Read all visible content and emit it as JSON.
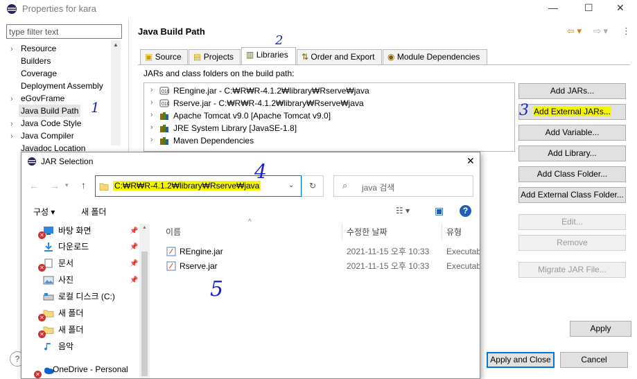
{
  "window": {
    "title": "Properties for kara",
    "filter_placeholder": "type filter text",
    "tree": [
      "Resource",
      "Builders",
      "Coverage",
      "Deployment Assembly",
      "eGovFrame",
      "Java Build Path",
      "Java Code Style",
      "Java Compiler",
      "Javadoc Location"
    ]
  },
  "page": {
    "heading": "Java Build Path",
    "tabs": [
      "Source",
      "Projects",
      "Libraries",
      "Order and Export",
      "Module Dependencies"
    ],
    "jars_label": "JARs and class folders on the build path:",
    "entries": [
      "REngine.jar - C:₩R₩R-4.1.2₩library₩Rserve₩java",
      "Rserve.jar - C:₩R₩R-4.1.2₩library₩Rserve₩java",
      "Apache Tomcat v9.0 [Apache Tomcat v9.0]",
      "JRE System Library [JavaSE-1.8]",
      "Maven Dependencies"
    ],
    "buttons": [
      "Add JARs...",
      "Add External JARs...",
      "Add Variable...",
      "Add Library...",
      "Add Class Folder...",
      "Add External Class Folder...",
      "Edit...",
      "Remove",
      "Migrate JAR File..."
    ],
    "apply": "Apply",
    "apply_close": "Apply and Close",
    "cancel": "Cancel"
  },
  "annotations": [
    "1",
    "2",
    "3",
    "4",
    "5"
  ],
  "dialog": {
    "title": "JAR Selection",
    "path": "C:₩R₩R-4.1.2₩library₩Rserve₩java",
    "search_placeholder": "java 검색",
    "organize": "구성 ▾",
    "new_folder": "새 폴더",
    "nav": [
      {
        "label": "바탕 화면",
        "pinned": true
      },
      {
        "label": "다운로드",
        "pinned": true
      },
      {
        "label": "문서",
        "pinned": true
      },
      {
        "label": "사진",
        "pinned": true
      },
      {
        "label": "로컬 디스크 (C:)",
        "pinned": false
      },
      {
        "label": "새 폴더",
        "pinned": false
      },
      {
        "label": "새 폴더",
        "pinned": false
      },
      {
        "label": "음악",
        "pinned": false
      },
      {
        "label": "OneDrive - Personal",
        "pinned": false
      }
    ],
    "columns": {
      "name": "이름",
      "date": "수정한 날짜",
      "type": "유형"
    },
    "files": [
      {
        "name": "REngine.jar",
        "date": "2021-11-15 오후 10:33",
        "type": "Executabl"
      },
      {
        "name": "Rserve.jar",
        "date": "2021-11-15 오후 10:33",
        "type": "Executabl"
      }
    ]
  },
  "colors": {
    "highlight": "#f5f500",
    "annotation": "#1a23c9",
    "focus": "#0078d7"
  }
}
